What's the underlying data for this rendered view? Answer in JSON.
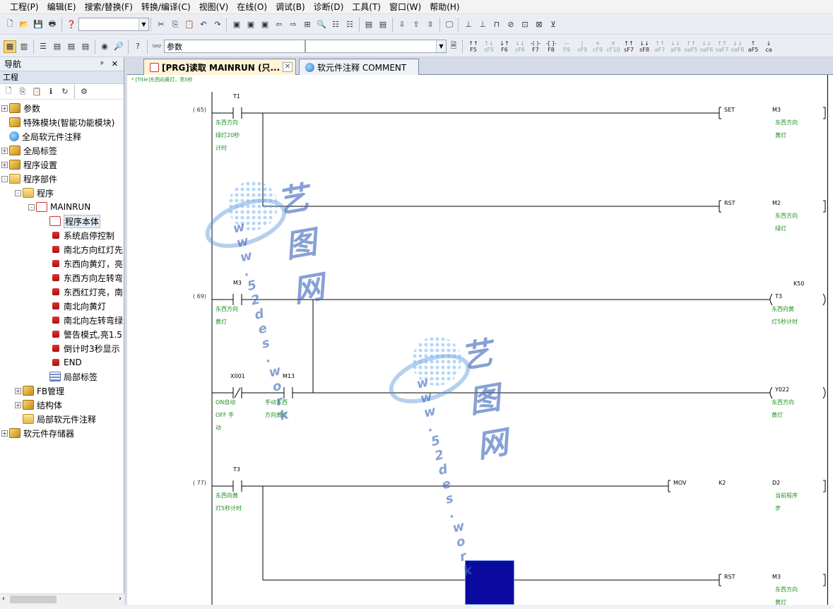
{
  "menubar": {
    "items": [
      "工程(P)",
      "编辑(E)",
      "搜索/替换(F)",
      "转换/编译(C)",
      "视图(V)",
      "在线(O)",
      "调试(B)",
      "诊断(D)",
      "工具(T)",
      "窗口(W)",
      "帮助(H)"
    ]
  },
  "toolbar2": {
    "combo_value": "参数"
  },
  "fkeys": [
    {
      "top": "↑↑",
      "label": "F5",
      "dim": false
    },
    {
      "top": "↑↓",
      "label": "sF5",
      "dim": true
    },
    {
      "top": "↓↑",
      "label": "F6",
      "dim": false
    },
    {
      "top": "↓↓",
      "label": "sF6",
      "dim": true
    },
    {
      "top": "-( )-",
      "label": "F7",
      "dim": false
    },
    {
      "top": "-[ ]-",
      "label": "F8",
      "dim": false
    },
    {
      "top": "—",
      "label": "F9",
      "dim": true
    },
    {
      "top": "|",
      "label": "sF9",
      "dim": true
    },
    {
      "top": "✕",
      "label": "cF9",
      "dim": true
    },
    {
      "top": "✕",
      "label": "cF10",
      "dim": true
    },
    {
      "top": "↑↑",
      "label": "sF7",
      "dim": false
    },
    {
      "top": "↓↓",
      "label": "sF8",
      "dim": false
    },
    {
      "top": "↑↑",
      "label": "aF7",
      "dim": true
    },
    {
      "top": "↓↓",
      "label": "aF8",
      "dim": true
    },
    {
      "top": "↑↑",
      "label": "saF5",
      "dim": true
    },
    {
      "top": "↓↓",
      "label": "saF6",
      "dim": true
    },
    {
      "top": "↑↑",
      "label": "saF7",
      "dim": true
    },
    {
      "top": "↓↓",
      "label": "saF8",
      "dim": true
    },
    {
      "top": "↑",
      "label": "aF5",
      "dim": false
    },
    {
      "top": "↓",
      "label": "ca",
      "dim": false
    }
  ],
  "nav": {
    "title": "导航",
    "pin": "ᵖ",
    "close": "✕",
    "section": "工程",
    "tree": [
      {
        "depth": 0,
        "pm": "+",
        "icon": "book",
        "label": "参数"
      },
      {
        "depth": 0,
        "pm": "",
        "icon": "book",
        "label": "特殊模块(智能功能模块)"
      },
      {
        "depth": 0,
        "pm": "",
        "icon": "globe",
        "label": "全局软元件注释"
      },
      {
        "depth": 0,
        "pm": "+",
        "icon": "book",
        "label": "全局标签"
      },
      {
        "depth": 0,
        "pm": "+",
        "icon": "book",
        "label": "程序设置"
      },
      {
        "depth": 0,
        "pm": "-",
        "icon": "folder",
        "label": "程序部件"
      },
      {
        "depth": 1,
        "pm": "-",
        "icon": "folder",
        "label": "程序"
      },
      {
        "depth": 2,
        "pm": "-",
        "icon": "prog",
        "label": "MAINRUN"
      },
      {
        "depth": 3,
        "pm": "",
        "icon": "prog",
        "label": "程序本体"
      },
      {
        "depth": 3,
        "pm": "",
        "icon": "small",
        "label": "系统启停控制"
      },
      {
        "depth": 3,
        "pm": "",
        "icon": "small",
        "label": "南北方向红灯先"
      },
      {
        "depth": 3,
        "pm": "",
        "icon": "small",
        "label": "东西向黄灯，亮"
      },
      {
        "depth": 3,
        "pm": "",
        "icon": "small",
        "label": "东西方向左转弯"
      },
      {
        "depth": 3,
        "pm": "",
        "icon": "small",
        "label": "东西红灯亮，南"
      },
      {
        "depth": 3,
        "pm": "",
        "icon": "small",
        "label": "南北向黄灯"
      },
      {
        "depth": 3,
        "pm": "",
        "icon": "small",
        "label": "南北向左转弯绿"
      },
      {
        "depth": 3,
        "pm": "",
        "icon": "small",
        "label": "警告模式,亮1.5"
      },
      {
        "depth": 3,
        "pm": "",
        "icon": "small",
        "label": "倒计时3秒显示"
      },
      {
        "depth": 3,
        "pm": "",
        "icon": "small",
        "label": "END"
      },
      {
        "depth": 3,
        "pm": "",
        "icon": "grid",
        "label": "局部标签"
      },
      {
        "depth": 1,
        "pm": "+",
        "icon": "book",
        "label": "FB管理"
      },
      {
        "depth": 1,
        "pm": "+",
        "icon": "book",
        "label": "结构体"
      },
      {
        "depth": 1,
        "pm": "",
        "icon": "folder",
        "label": "局部软元件注释"
      },
      {
        "depth": 0,
        "pm": "+",
        "icon": "book",
        "label": "软元件存储器"
      }
    ]
  },
  "tabs": [
    {
      "label": "[PRG]读取 MAINRUN (只...",
      "active": true
    },
    {
      "label": "软元件注释 COMMENT",
      "active": false
    }
  ],
  "editor": {
    "title_comment": "* [Title]东西向黄灯，亮5秒",
    "steps": [
      {
        "no": "(    65)"
      },
      {
        "no": "(    69)"
      },
      {
        "no": "(    77)"
      }
    ],
    "contacts": [
      {
        "device": "T1",
        "comment": [
          "东西方向",
          "绿灯20秒",
          "计时"
        ]
      },
      {
        "device": "M3",
        "comment": [
          "东西方向",
          "黄灯"
        ]
      },
      {
        "device": "X001",
        "comment": [
          "ON自动",
          "OFF 手",
          "动"
        ]
      },
      {
        "device": "M13",
        "comment": [
          "手动东西",
          "方向黄灯"
        ]
      },
      {
        "device": "T3",
        "comment": [
          "东西向黄",
          "灯5秒计时"
        ]
      }
    ],
    "coils": [
      {
        "instr": "SET",
        "device": "M3",
        "comment": [
          "东西方向",
          "黄灯"
        ]
      },
      {
        "instr": "RST",
        "device": "M2",
        "comment": [
          "东西方向",
          "绿灯"
        ]
      },
      {
        "instr": "",
        "device": "T3",
        "const": "K50",
        "comment": [
          "东西向黄",
          "灯5秒计时"
        ]
      },
      {
        "instr": "",
        "device": "Y022",
        "comment": [
          "东西方向",
          "黄灯"
        ]
      },
      {
        "instr": "MOV",
        "device": "D2",
        "const": "K2",
        "comment": [
          "当前程序",
          "步"
        ]
      },
      {
        "instr": "RST",
        "device": "M3",
        "comment": [
          "东西方向",
          "黄灯"
        ]
      }
    ]
  },
  "watermark": {
    "cn": "艺图网",
    "url": "w w w . 5 2 d e s . w o r k"
  },
  "colors": {
    "cursor_block": "#0a0aa0",
    "comment_green": "#1c8f1c",
    "tab_active": "#fff4d6"
  }
}
